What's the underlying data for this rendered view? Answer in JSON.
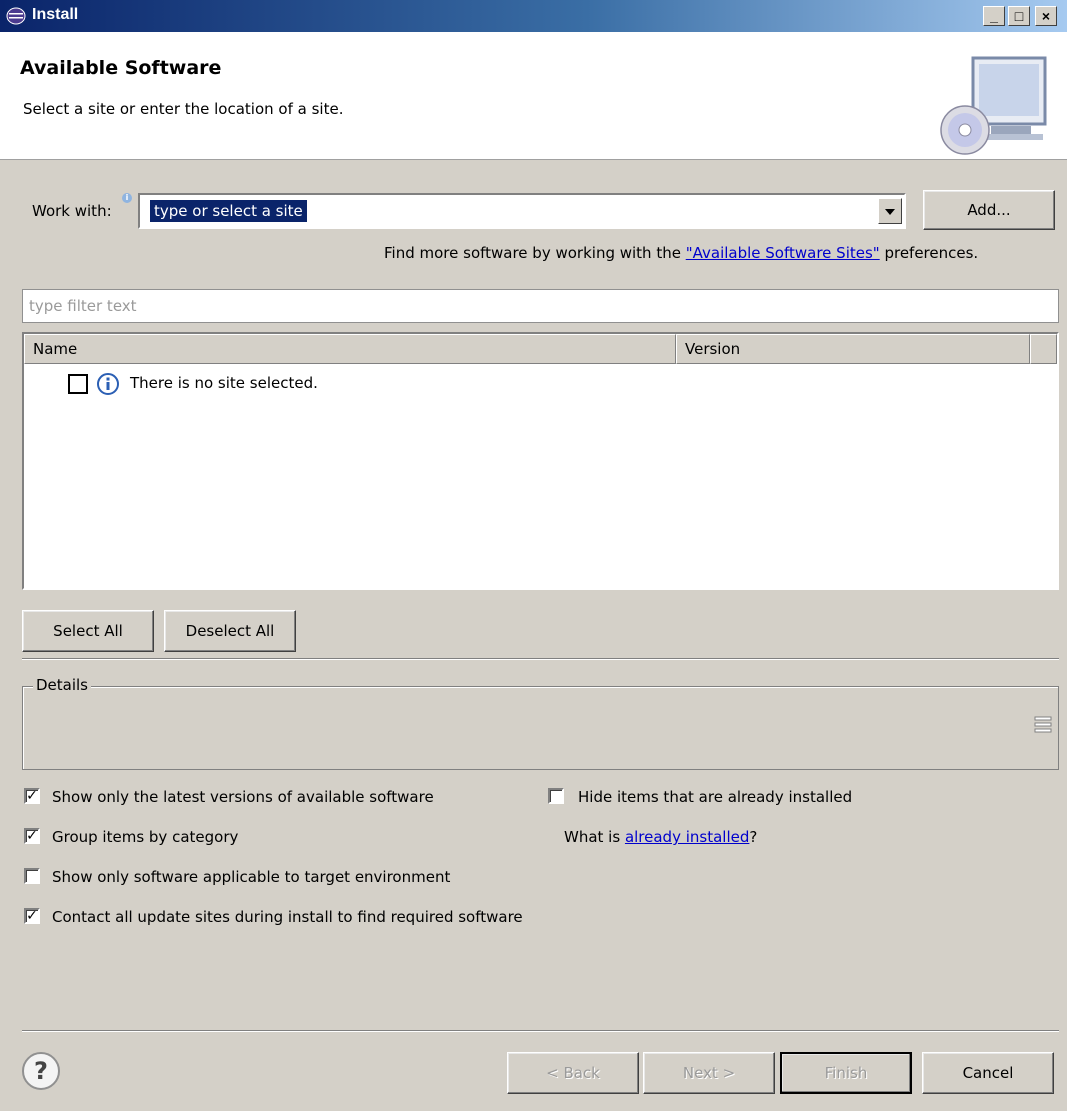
{
  "window": {
    "title": "Install"
  },
  "header": {
    "title": "Available Software",
    "subtitle": "Select a site or enter the location of a site."
  },
  "work_with": {
    "label": "Work with:",
    "value": "type or select a site",
    "add_label": "Add...",
    "find_more_prefix": "Find more software by working with the ",
    "find_more_link": "\"Available Software Sites\"",
    "find_more_suffix": " preferences."
  },
  "filter": {
    "placeholder": "type filter text"
  },
  "table": {
    "columns": [
      "Name",
      "Version"
    ],
    "rows": [
      {
        "text": "There is no site selected."
      }
    ]
  },
  "selection": {
    "select_all": "Select All",
    "deselect_all": "Deselect All"
  },
  "details": {
    "label": "Details"
  },
  "options": {
    "latest_versions": {
      "label": "Show only the latest versions of available software",
      "checked": true
    },
    "group_by_category": {
      "label": "Group items by category",
      "checked": true
    },
    "target_env": {
      "label": "Show only software applicable to target environment",
      "checked": false
    },
    "contact_sites": {
      "label": "Contact all update sites during install to find required software",
      "checked": true
    },
    "hide_installed": {
      "label": "Hide items that are already installed",
      "checked": false
    },
    "what_is_prefix": "What is ",
    "what_is_link": "already installed",
    "what_is_suffix": "?"
  },
  "footer": {
    "help": "?",
    "back": "< Back",
    "next": "Next >",
    "finish": "Finish",
    "cancel": "Cancel"
  },
  "window_controls": {
    "minimize": "_",
    "maximize": "□",
    "close": "×"
  }
}
